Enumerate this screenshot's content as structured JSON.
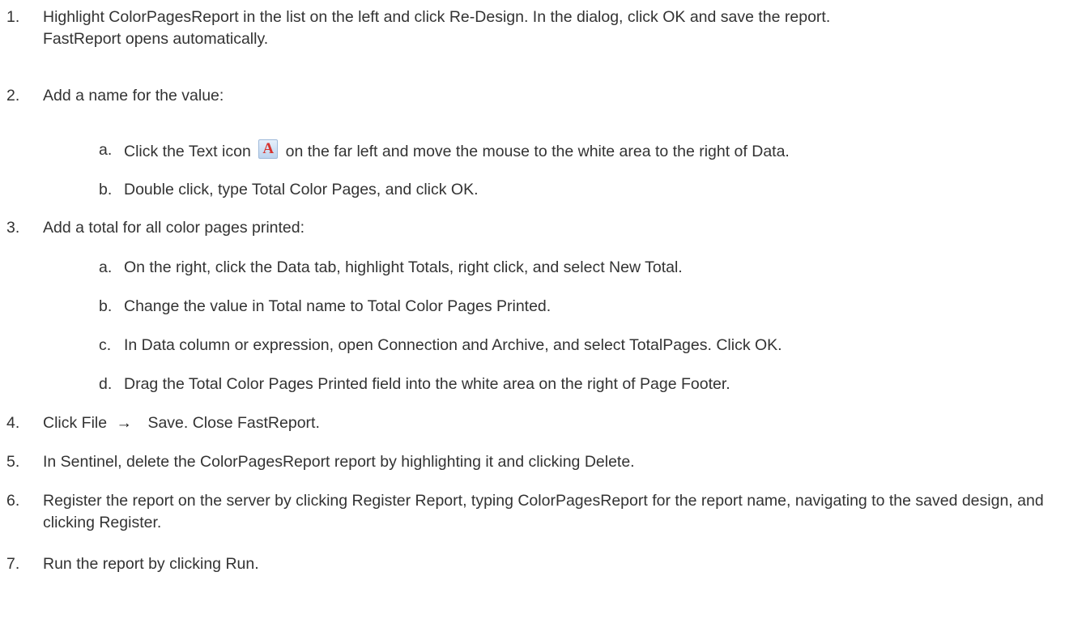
{
  "steps": [
    {
      "num": "1.",
      "line1": "Highlight ColorPagesReport in the list on the left and click Re-Design. In the dialog, click OK and save the report.",
      "line2": "FastReport opens automatically."
    },
    {
      "num": "2.",
      "text": "Add a name for the value:"
    },
    {
      "num": "3.",
      "text": "Add a total for all color pages printed:"
    },
    {
      "num": "4.",
      "text_before": "Click File",
      "arrow": "→",
      "text_after": "Save. Close FastReport."
    },
    {
      "num": "5.",
      "text": "In Sentinel, delete the ColorPagesReport report by highlighting it and clicking Delete."
    },
    {
      "num": "6.",
      "text": "Register the report on the server by clicking Register Report, typing ColorPagesReport for the report name, navigating to the saved design, and clicking Register."
    },
    {
      "num": "7.",
      "text": "Run the report by clicking Run."
    }
  ],
  "step2_sub": [
    {
      "letter": "a.",
      "before": "Click the Text icon",
      "icon_glyph": "A",
      "after": "on the far left and move the mouse to the white area to the right of Data."
    },
    {
      "letter": "b.",
      "text": "Double click, type Total Color Pages, and click OK."
    }
  ],
  "step3_sub": [
    {
      "letter": "a.",
      "text": "On the right, click the Data tab, highlight Totals, right click, and select New Total."
    },
    {
      "letter": "b.",
      "text": "Change the value in Total name to Total Color Pages Printed."
    },
    {
      "letter": "c.",
      "text": "In Data column or expression, open Connection and Archive, and select TotalPages. Click OK."
    },
    {
      "letter": "d.",
      "text": "Drag the Total Color Pages Printed field into the white area on the right of Page Footer."
    }
  ],
  "icons": {
    "text_icon": "text-tool-icon",
    "arrow": "right-arrow-icon"
  }
}
